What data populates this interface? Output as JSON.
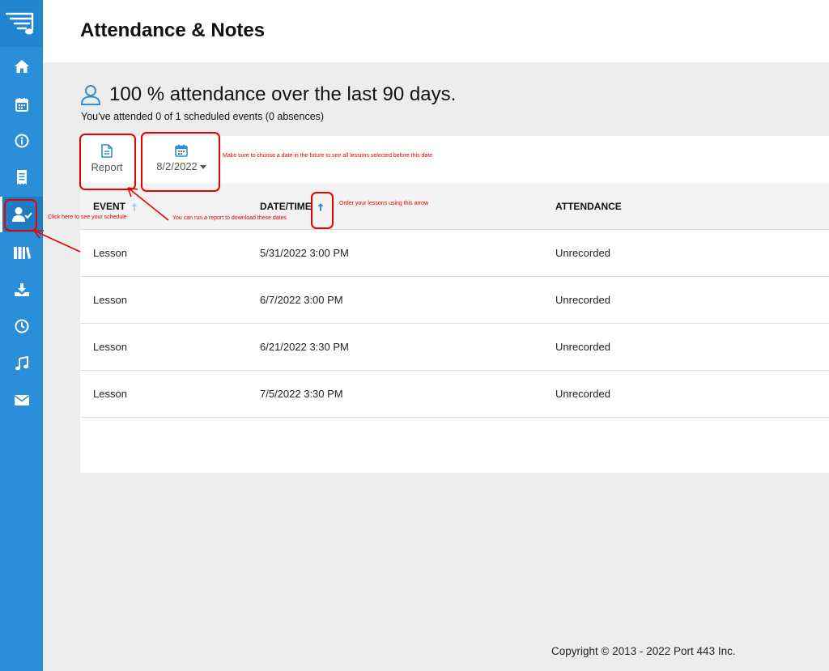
{
  "page": {
    "title": "Attendance & Notes"
  },
  "sidebar": {
    "logo": "sheet-music-menu-icon",
    "items": [
      {
        "name": "home",
        "icon": "home-icon"
      },
      {
        "name": "calendar",
        "icon": "calendar-icon"
      },
      {
        "name": "info",
        "icon": "info-icon"
      },
      {
        "name": "billing",
        "icon": "receipt-icon"
      },
      {
        "name": "attendance",
        "icon": "user-check-icon",
        "active": true
      },
      {
        "name": "library",
        "icon": "books-icon"
      },
      {
        "name": "downloads",
        "icon": "download-icon"
      },
      {
        "name": "history",
        "icon": "clock-icon"
      },
      {
        "name": "music",
        "icon": "music-note-icon"
      },
      {
        "name": "messages",
        "icon": "envelope-icon"
      }
    ]
  },
  "summary": {
    "headline": "100 % attendance over the last 90 days.",
    "detail": "You've attended 0 of 1 scheduled events (0 absences)"
  },
  "toolbar": {
    "report_label": "Report",
    "date_value": "8/2/2022"
  },
  "table": {
    "headers": {
      "event": "EVENT",
      "datetime": "DATE/TIME",
      "attendance": "ATTENDANCE"
    },
    "rows": [
      {
        "event": "Lesson",
        "datetime": "5/31/2022 3:00 PM",
        "attendance": "Unrecorded"
      },
      {
        "event": "Lesson",
        "datetime": "6/7/2022 3:00 PM",
        "attendance": "Unrecorded"
      },
      {
        "event": "Lesson",
        "datetime": "6/21/2022 3:30 PM",
        "attendance": "Unrecorded"
      },
      {
        "event": "Lesson",
        "datetime": "7/5/2022 3:30 PM",
        "attendance": "Unrecorded"
      }
    ]
  },
  "annotations": {
    "date_note": "Make sure to choose a date in the future to see all lessons selected before this date",
    "sort_note": "Order your lessons using this arrow",
    "schedule_note": "Click here to see your schedule",
    "report_note": "You can run a report to download these dates"
  },
  "colors": {
    "sidebar": "#2a8fd8",
    "accent": "#2a8fd8",
    "annotation": "#e60000"
  },
  "footer": {
    "copyright": "Copyright © 2013 - 2022 Port 443 Inc."
  }
}
